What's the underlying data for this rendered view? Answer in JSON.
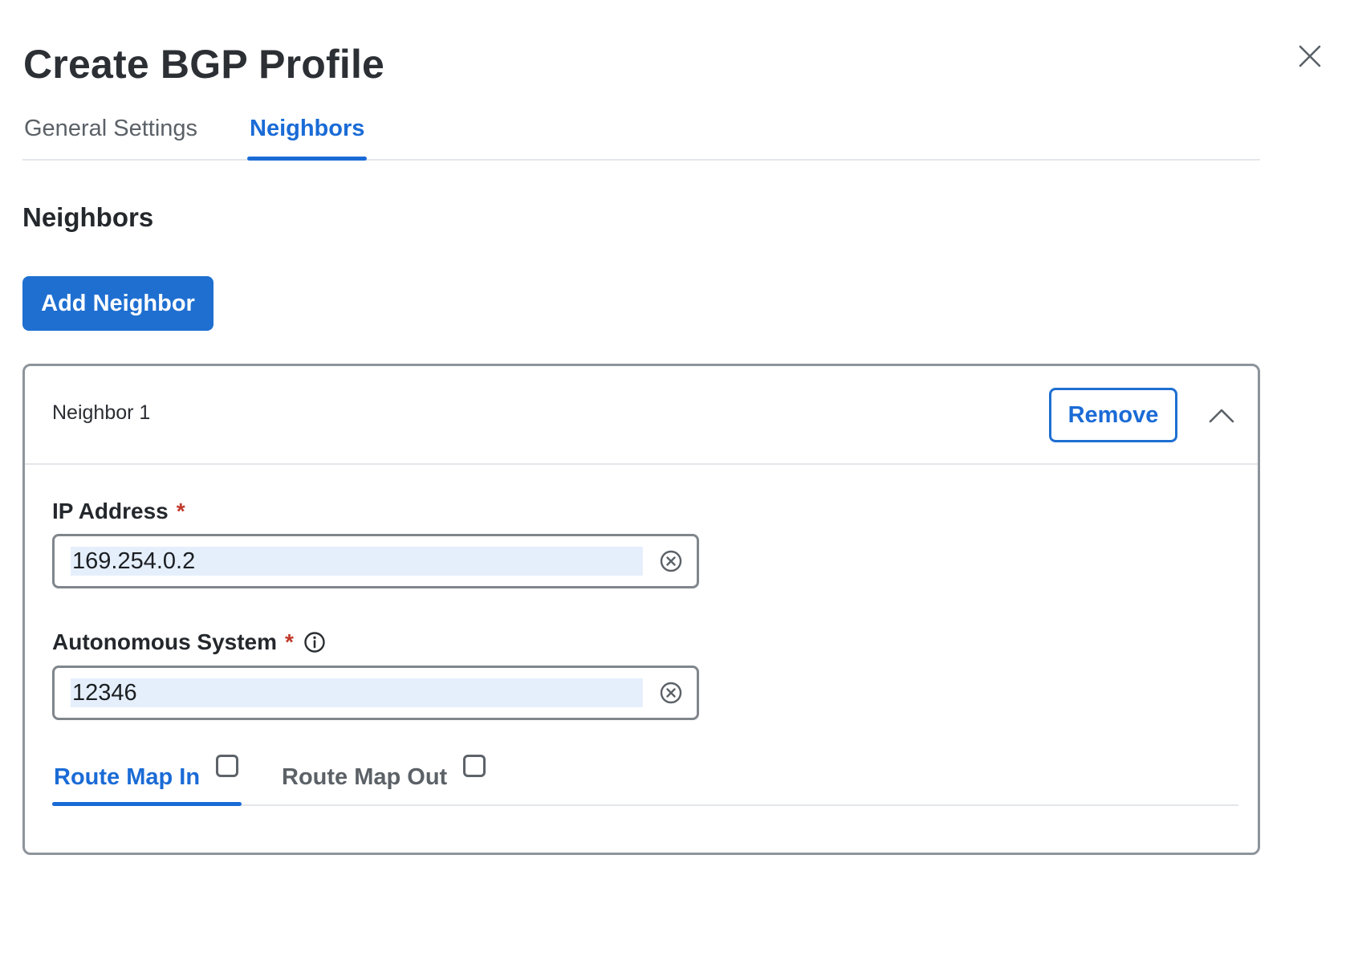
{
  "dialog": {
    "title": "Create BGP Profile"
  },
  "tabs": [
    {
      "label": "General Settings",
      "active": false
    },
    {
      "label": "Neighbors",
      "active": true
    }
  ],
  "section": {
    "heading": "Neighbors",
    "add_button_label": "Add Neighbor"
  },
  "neighbor": {
    "title": "Neighbor 1",
    "remove_label": "Remove",
    "ip_address": {
      "label": "IP Address",
      "required_mark": "*",
      "value": "169.254.0.2"
    },
    "autonomous_system": {
      "label": "Autonomous System",
      "required_mark": "*",
      "value": "12346"
    },
    "route_tabs": [
      {
        "label": "Route Map In",
        "active": true,
        "checked": false
      },
      {
        "label": "Route Map Out",
        "active": false,
        "checked": false
      }
    ]
  },
  "icons": {
    "close": "close-icon",
    "collapse": "chevron-up-icon",
    "clear": "clear-circle-icon",
    "info": "info-icon"
  },
  "colors": {
    "accent": "#1a6bd6",
    "required": "#c0392b",
    "input_highlight": "#e5effc"
  }
}
